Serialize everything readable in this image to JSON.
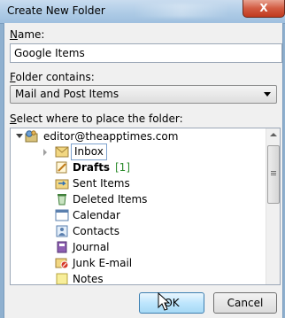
{
  "window": {
    "title": "Create New Folder",
    "close_label": "X"
  },
  "name": {
    "label_prefix": "",
    "label_key": "N",
    "label_rest": "ame:",
    "value": "Google Items"
  },
  "contains": {
    "label_key": "F",
    "label_rest": "older contains:",
    "value": "Mail and Post Items"
  },
  "location": {
    "label_key": "S",
    "label_rest": "elect where to place the folder:"
  },
  "tree": {
    "account": "editor@theapptimes.com",
    "items": [
      {
        "label": "Inbox",
        "icon": "inbox-icon"
      },
      {
        "label": "Drafts",
        "count": "[1]",
        "icon": "drafts-icon"
      },
      {
        "label": "Sent Items",
        "icon": "sent-items-icon"
      },
      {
        "label": "Deleted Items",
        "icon": "deleted-items-icon"
      },
      {
        "label": "Calendar",
        "icon": "calendar-icon"
      },
      {
        "label": "Contacts",
        "icon": "contacts-icon"
      },
      {
        "label": "Journal",
        "icon": "journal-icon"
      },
      {
        "label": "Junk E-mail",
        "icon": "junk-email-icon"
      },
      {
        "label": "Notes",
        "icon": "notes-icon"
      }
    ]
  },
  "buttons": {
    "ok": "OK",
    "cancel": "Cancel"
  }
}
